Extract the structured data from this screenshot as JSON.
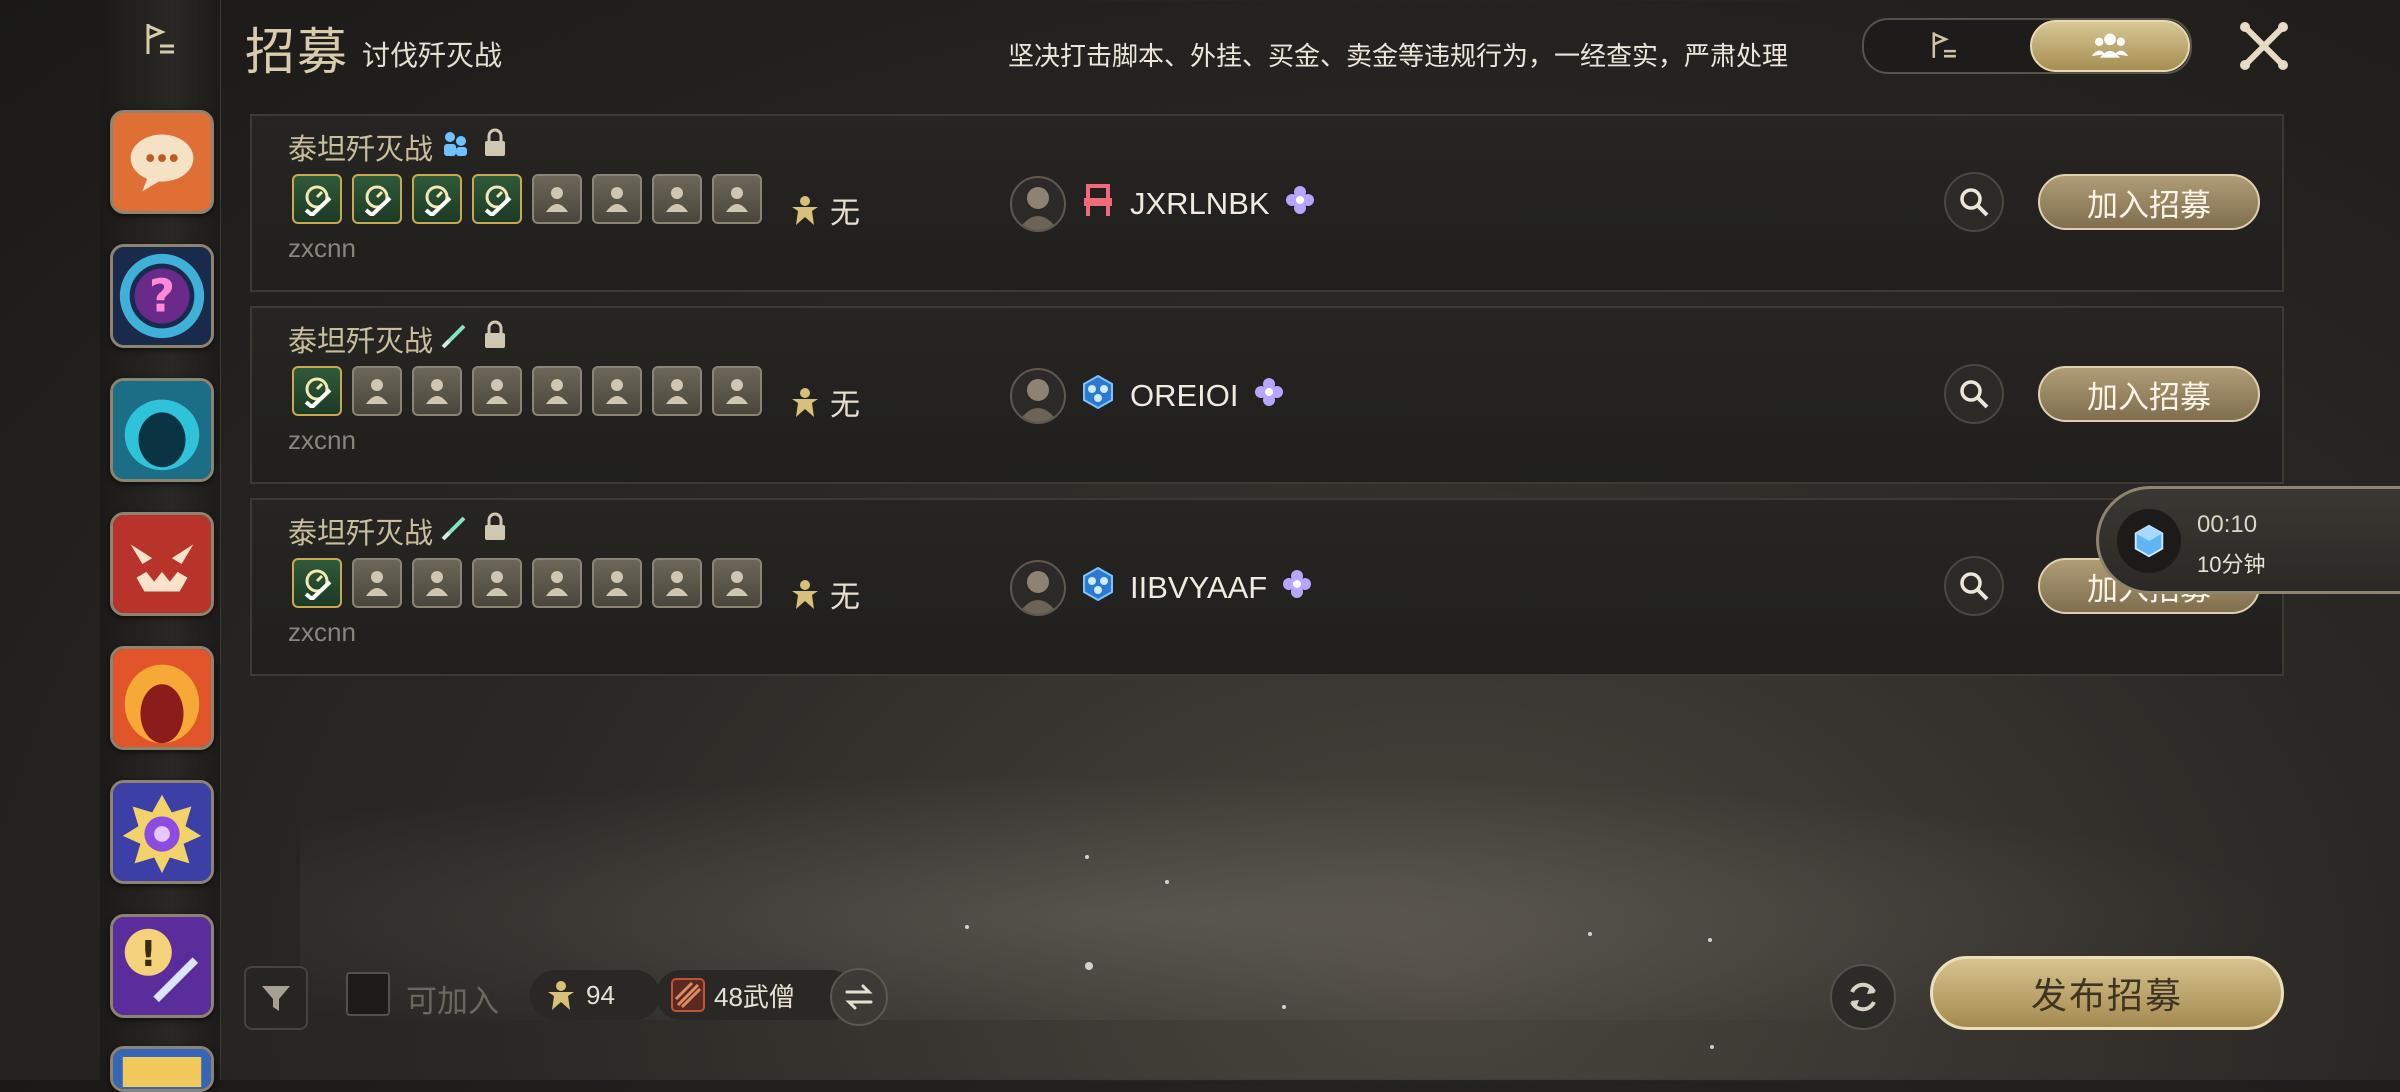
{
  "header": {
    "title": "招募",
    "subtitle": "讨伐歼灭战",
    "notice": "坚决打击脚本、外挂、买金、卖金等违规行为，一经查实，严肃处理",
    "toggle": {
      "options": [
        "list-flag-icon",
        "party-icon"
      ],
      "selected": 1
    }
  },
  "sidebar": {
    "items": [
      "chat-bubble-icon",
      "question-icon",
      "portal-icon",
      "demon-mask-icon",
      "fire-cave-icon",
      "star-crystal-icon",
      "sword-alert-icon",
      "ticket-icon"
    ]
  },
  "recruits": [
    {
      "title": "泰坦歼灭战",
      "role_icon": "party-roles-icon",
      "filled_slots": 4,
      "total_slots": 8,
      "requirement": "无",
      "owner": "zxcnn",
      "leader_job_icon": "chair-icon",
      "leader_name": "JXRLNBK",
      "join_label": "加入招募"
    },
    {
      "title": "泰坦歼灭战",
      "role_icon": "sword-icon",
      "filled_slots": 1,
      "total_slots": 8,
      "requirement": "无",
      "owner": "zxcnn",
      "leader_job_icon": "party-shield-icon",
      "leader_name": "OREIOI",
      "join_label": "加入招募"
    },
    {
      "title": "泰坦歼灭战",
      "role_icon": "sword-icon",
      "filled_slots": 1,
      "total_slots": 8,
      "requirement": "无",
      "owner": "zxcnn",
      "leader_job_icon": "party-shield-icon",
      "leader_name": "IIBVYAAF",
      "join_label": "加入招募"
    }
  ],
  "timer": {
    "time": "00:10",
    "label": "10分钟"
  },
  "footer": {
    "joinable_label": "可加入",
    "item_level": "94",
    "job": "48武僧",
    "publish_label": "发布招募"
  },
  "colors": {
    "accent": "#c8b27a",
    "slot_filled": "#2f5a3a",
    "background": "#2b2925"
  }
}
